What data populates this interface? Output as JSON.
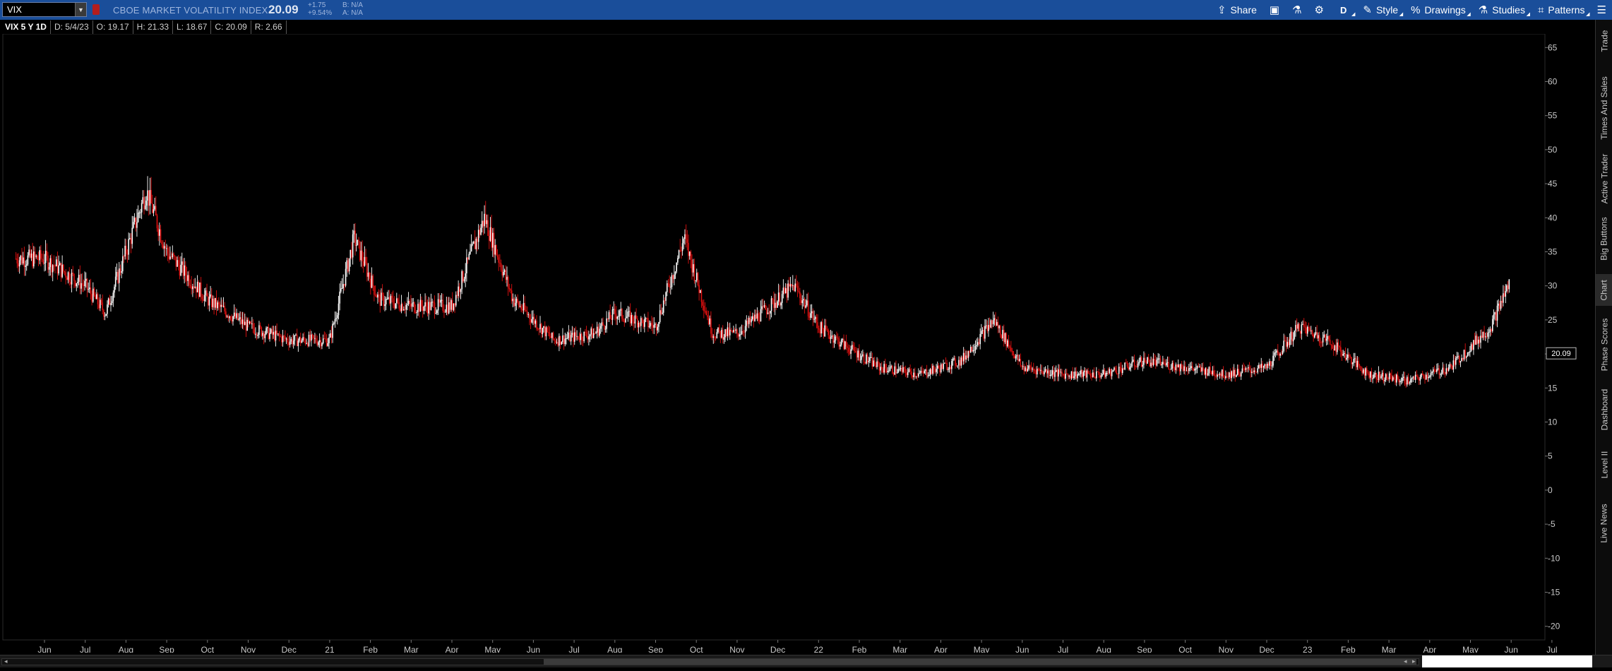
{
  "toolbar": {
    "symbol": "VIX",
    "description": "CBOE MARKET VOLATILITY INDEX",
    "last": "20.09",
    "net_change": "+1.75",
    "pct_change": "+9.54%",
    "bid": "B: N/A",
    "ask": "A: N/A",
    "share_label": "Share",
    "period_label": "D",
    "style_label": "Style",
    "drawings_label": "Drawings",
    "studies_label": "Studies",
    "patterns_label": "Patterns",
    "accent_color": "#1a4e9a"
  },
  "info": {
    "title": "VIX 5 Y 1D",
    "date": "D: 5/4/23",
    "open": "O: 19.17",
    "high": "H: 21.33",
    "low": "L: 18.67",
    "close": "C: 20.09",
    "range": "R: 2.66"
  },
  "right_tabs": [
    "Trade",
    "Times And Sales",
    "Active Trader",
    "Big Buttons",
    "Chart",
    "Phase Scores",
    "Dashboard",
    "Level II",
    "Live News"
  ],
  "chart_data": {
    "type": "candlestick",
    "y_axis_ticks": [
      65,
      60,
      55,
      50,
      45,
      40,
      35,
      30,
      25,
      20,
      15,
      10,
      5,
      0,
      -5,
      -10,
      -15,
      -20
    ],
    "ylim": [
      -22,
      67
    ],
    "x_tick_labels": [
      "Jun",
      "Jul",
      "Aug",
      "Sep",
      "Oct",
      "Nov",
      "Dec",
      "21",
      "Feb",
      "Mar",
      "Apr",
      "May",
      "Jun",
      "Jul",
      "Aug",
      "Sep",
      "Oct",
      "Nov",
      "Dec",
      "22",
      "Feb",
      "Mar",
      "Apr",
      "May",
      "Jun",
      "Jul",
      "Aug",
      "Sep",
      "Oct",
      "Nov",
      "Dec",
      "23",
      "Feb",
      "Mar",
      "Apr",
      "May",
      "Jun",
      "Jul"
    ],
    "last_price_label": "20.09",
    "series_profile": [
      [
        0,
        34
      ],
      [
        1,
        30
      ],
      [
        1.5,
        26
      ],
      [
        2.5,
        44
      ],
      [
        3,
        35
      ],
      [
        4,
        28
      ],
      [
        5,
        24
      ],
      [
        6,
        22
      ],
      [
        7,
        22
      ],
      [
        7.6,
        37
      ],
      [
        8.2,
        28
      ],
      [
        9,
        27
      ],
      [
        10,
        27
      ],
      [
        10.8,
        40
      ],
      [
        11.5,
        28
      ],
      [
        12.5,
        22
      ],
      [
        13.5,
        23
      ],
      [
        14,
        26
      ],
      [
        15,
        24
      ],
      [
        15.7,
        37
      ],
      [
        16.4,
        23
      ],
      [
        17,
        23
      ],
      [
        18.4,
        30
      ],
      [
        19,
        24
      ],
      [
        19.7,
        21
      ],
      [
        20.5,
        18
      ],
      [
        21.5,
        17
      ],
      [
        22.5,
        19
      ],
      [
        23.3,
        25
      ],
      [
        24,
        18
      ],
      [
        25,
        17
      ],
      [
        26,
        17
      ],
      [
        27,
        19
      ],
      [
        28,
        18
      ],
      [
        29,
        17
      ],
      [
        30,
        18
      ],
      [
        30.8,
        24
      ],
      [
        31.5,
        22
      ],
      [
        32.5,
        17
      ],
      [
        33.5,
        16
      ],
      [
        34.5,
        18
      ],
      [
        35.5,
        24
      ],
      [
        36,
        31
      ],
      [
        37,
        21
      ],
      [
        38,
        19
      ],
      [
        38.6,
        22
      ],
      [
        39.3,
        33
      ],
      [
        40,
        24
      ],
      [
        41,
        29
      ],
      [
        42,
        34
      ],
      [
        43,
        27
      ],
      [
        44,
        21
      ],
      [
        44.7,
        22
      ],
      [
        45.5,
        31
      ],
      [
        46.5,
        33
      ],
      [
        47.5,
        28
      ],
      [
        48,
        26
      ],
      [
        49,
        32
      ],
      [
        50,
        29
      ],
      [
        51,
        25
      ],
      [
        52,
        23
      ],
      [
        53,
        21
      ],
      [
        54.5,
        27
      ],
      [
        55.5,
        28
      ],
      [
        56.5,
        34
      ],
      [
        57,
        32
      ],
      [
        58,
        27
      ],
      [
        59,
        24
      ],
      [
        60,
        22
      ],
      [
        61,
        23
      ],
      [
        62,
        21
      ],
      [
        63,
        20
      ],
      [
        64,
        20
      ],
      [
        65,
        22
      ],
      [
        66,
        20
      ],
      [
        67,
        22
      ],
      [
        67.6,
        29
      ],
      [
        68.2,
        24
      ],
      [
        69,
        19
      ],
      [
        70,
        18
      ],
      [
        71,
        18
      ],
      [
        71.5,
        20
      ]
    ]
  }
}
